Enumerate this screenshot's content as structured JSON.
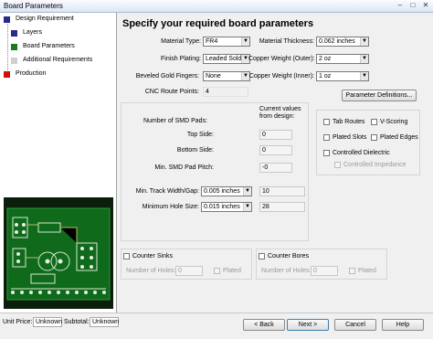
{
  "window": {
    "title": "Board Parameters",
    "minimize": "‒",
    "maximize": "□",
    "close": "✕"
  },
  "sidebar": {
    "items": [
      {
        "label": "Design Requirement",
        "color": "#2a2a8a"
      },
      {
        "label": "Layers",
        "color": "#2a2a8a"
      },
      {
        "label": "Board Parameters",
        "color": "#1e7a1e"
      },
      {
        "label": "Additional Requirements",
        "color": "#cfcfcf"
      },
      {
        "label": "Production",
        "color": "#d01010"
      }
    ]
  },
  "heading": "Specify your required board parameters",
  "params": {
    "material_type": {
      "label": "Material Type:",
      "value": "FR4"
    },
    "finish_plating": {
      "label": "Finish Plating:",
      "value": "Leaded Solder"
    },
    "beveled_gold": {
      "label": "Beveled Gold Fingers:",
      "value": "None"
    },
    "cnc_route": {
      "label": "CNC Route Points:",
      "value": "4"
    },
    "material_thickness": {
      "label": "Material Thickness:",
      "value": "0.062 inches"
    },
    "copper_outer": {
      "label": "Copper Weight (Outer):",
      "value": "2 oz"
    },
    "copper_inner": {
      "label": "Copper Weight (Inner):",
      "value": "1 oz"
    },
    "param_defs_button": "Parameter Definitions..."
  },
  "smd": {
    "pads_label": "Number of SMD Pads:",
    "current_values_label": "Current values from design:",
    "top_label": "Top Side:",
    "top_value": "0",
    "bottom_label": "Bottom Side:",
    "bottom_value": "0",
    "pitch_label": "Min. SMD Pad Pitch:",
    "pitch_value": "-0"
  },
  "track": {
    "label": "Min. Track Width/Gap:",
    "value": "0.005 inches",
    "current": "10"
  },
  "hole": {
    "label": "Minimum Hole Size:",
    "value": "0.015 inches",
    "current": "28"
  },
  "options": {
    "tab_routes": "Tab Routes",
    "v_scoring": "V-Scoring",
    "plated_slots": "Plated Slots",
    "plated_edges": "Plated Edges",
    "controlled_dielectric": "Controlled Dielectric",
    "controlled_impedance": "Controlled Impedance"
  },
  "counter_sinks": {
    "label": "Counter Sinks",
    "holes_label": "Number of Holes:",
    "holes_value": "0",
    "plated": "Plated"
  },
  "counter_bores": {
    "label": "Counter Bores",
    "holes_label": "Number of Holes:",
    "holes_value": "0",
    "plated": "Plated"
  },
  "footer": {
    "unit_price_label": "Unit Price:",
    "unit_price_value": "Unknown",
    "subtotal_label": "Subtotal:",
    "subtotal_value": "Unknown",
    "back": "< Back",
    "next": "Next >",
    "cancel": "Cancel",
    "help": "Help"
  }
}
